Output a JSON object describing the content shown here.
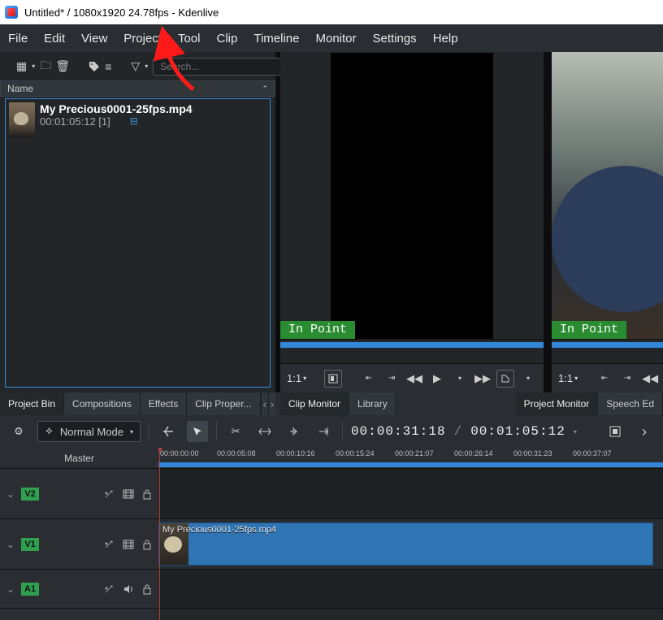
{
  "window": {
    "title": "Untitled* / 1080x1920 24.78fps - Kdenlive"
  },
  "menu": {
    "file": "File",
    "edit": "Edit",
    "view": "View",
    "project": "Project",
    "tool": "Tool",
    "clip": "Clip",
    "timeline": "Timeline",
    "monitor": "Monitor",
    "settings": "Settings",
    "help": "Help"
  },
  "bin": {
    "search_placeholder": "Search...",
    "header": "Name",
    "clip": {
      "name": "My Precious0001-25fps.mp4",
      "duration": "00:01:05:12 [1]"
    }
  },
  "monitor": {
    "in_label": "In Point",
    "zoom": "1:1"
  },
  "tabs": {
    "left": [
      "Project Bin",
      "Compositions",
      "Effects",
      "Clip Proper..."
    ],
    "mid": [
      "Clip Monitor",
      "Library"
    ],
    "right": [
      "Project Monitor",
      "Speech Ed"
    ]
  },
  "timeline": {
    "mode": "Normal Mode",
    "pos": "00:00:31:18",
    "total": "00:01:05:12",
    "master": "Master",
    "tracks": {
      "v2": "V2",
      "v1": "V1",
      "a1": "A1"
    },
    "ruler": [
      "00:00:00:00",
      "00:00:05:08",
      "00:00:10:16",
      "00:00:15:24",
      "00:00:21:07",
      "00:00:26:14",
      "00:00:31:23",
      "00:00:37:07"
    ],
    "clipname": "My Precious0001-25fps.mp4"
  }
}
